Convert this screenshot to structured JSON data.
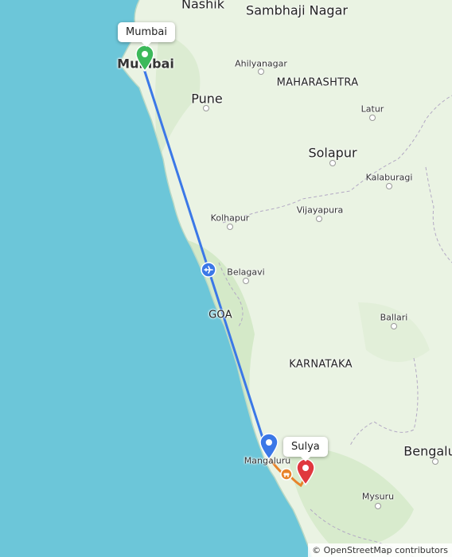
{
  "map": {
    "place_labels": {
      "nashik": "Nashik",
      "sambhaji_nagar": "Sambhaji Nagar",
      "mumbai": "Mumbai",
      "ahilyanagar": "Ahilyanagar",
      "maharashtra": "MAHARASHTRA",
      "pune": "Pune",
      "latur": "Latur",
      "solapur": "Solapur",
      "kalaburagi": "Kalaburagi",
      "kolhapur": "Kolhapur",
      "vijayapura": "Vijayapura",
      "belagavi": "Belagavi",
      "goa": "GOA",
      "ballari": "Ballari",
      "karnataka": "KARNATAKA",
      "mangaluru": "Mangaluru",
      "bengaluru": "Bengalu",
      "mysuru": "Mysuru"
    },
    "route": {
      "origin_label": "Mumbai",
      "destination_label": "Sulya",
      "flight_color": "#3b78e7",
      "drive_color": "#e8832a",
      "origin_marker_color": "#3cb95a",
      "destination_marker_color": "#e0383e",
      "waypoint_marker_color": "#3b78e7"
    },
    "icons": {
      "flight": "airplane-icon",
      "drive": "car-icon"
    },
    "colors": {
      "sea": "#6cc6d9",
      "land": "#eaf3e3"
    },
    "attribution": "© OpenStreetMap contributors"
  }
}
